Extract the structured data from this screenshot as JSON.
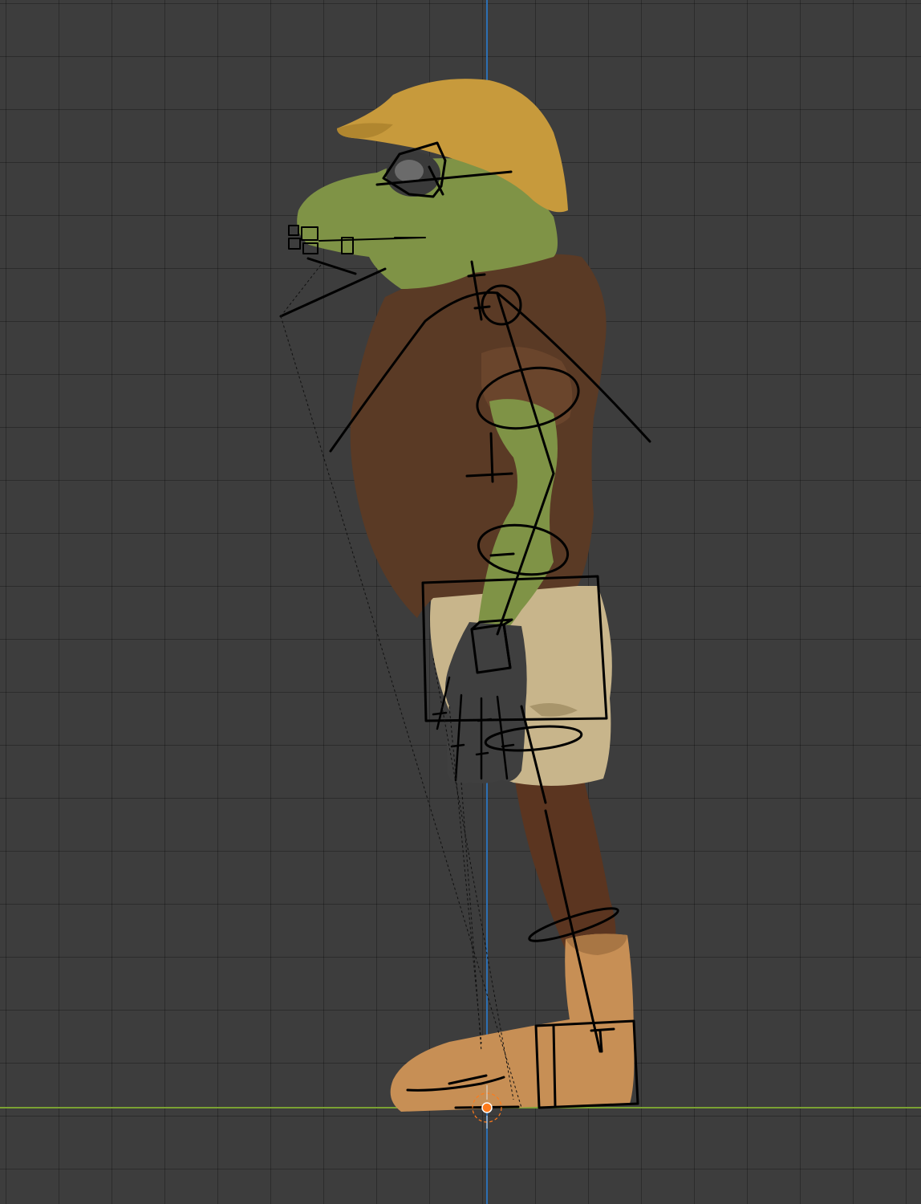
{
  "viewport": {
    "background_color": "#3d3d3d",
    "grid_color": "#2e2e2e",
    "axis_colors": {
      "x_axis": "#7aa133",
      "z_axis": "#2d6fb3"
    },
    "view": "side-orthographic"
  },
  "scene": {
    "character": {
      "type": "frog soldier figure",
      "colors": {
        "helmet": "#c79a3c",
        "skin": "#7f9346",
        "shirt": "#5a3a25",
        "shorts": "#c8b58b",
        "leg": "#5b3520",
        "glove": "#3f3f3f",
        "boot": "#c78f55"
      }
    },
    "armature": {
      "color": "#000000",
      "display": "wire"
    },
    "origin_3d_cursor": {
      "icon": "crosshair-icon",
      "color": "#ff7a1a"
    }
  }
}
